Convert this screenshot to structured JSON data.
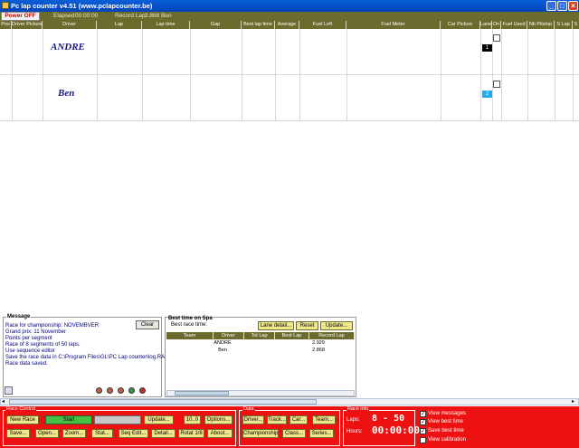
{
  "window": {
    "title": "Pc lap counter v4.51 (www.pclapcounter.be)"
  },
  "header": {
    "power_button": "Power OFF",
    "elapsed_label": "Elapsed :",
    "elapsed_value": "00:00:00",
    "record_label": "Record Lap:",
    "record_value": "2.868 Ben"
  },
  "columns": [
    "Pos",
    "Driver Picture",
    "Driver",
    "Lap",
    "Lap time",
    "Gap",
    "Best lap time",
    "Average",
    "Fuel Left",
    "Fuel Meter",
    "Car Picture",
    "Lane",
    "On",
    "Fuel Used",
    "Nb Pitstop",
    "S Lap",
    "S"
  ],
  "rows": [
    {
      "driver": "ANDRE",
      "lane": "1",
      "lane_color": "#000000"
    },
    {
      "driver": "Ben",
      "lane": "2",
      "lane_color": "#22aaee"
    }
  ],
  "message": {
    "title": "Message",
    "clear": "Clear",
    "lines": [
      "Race for championship: NOVEMBVER",
      "Grand prix: 11 November",
      "Points per segment",
      "Race of 8 segments of 50 laps.",
      "Use sequence editor",
      "Save the race data in C:\\Program Files\\GL\\PC Lap counter\\log.RAC",
      "Race data saved."
    ]
  },
  "best": {
    "title": "Best time on Spa",
    "subtitle": "Best race time:",
    "lane_detail": "Lane detail...",
    "reset": "Reset",
    "update": "Update...",
    "headers": [
      "Team",
      "Driver",
      "Tot Lap",
      "Best Lap",
      "Record Lap"
    ],
    "rows": [
      {
        "driver": "ANDRE",
        "record": "2.929"
      },
      {
        "driver": "Ben",
        "record": "2.868"
      }
    ]
  },
  "race_control": {
    "label": "Race Control",
    "new_race": "New Race",
    "start": "Start",
    "update": "Update...",
    "num": "10..0",
    "options": "Options...",
    "save": "Save...",
    "open": "Open...",
    "zoom": "Zoom...",
    "stat": "Stat...",
    "seq_edit": "Seq Edit...",
    "detail": "Detail...",
    "rotat": "Rotat 1/8",
    "about": "About..."
  },
  "data": {
    "label": "Data",
    "driver": "Driver...",
    "track": "Track...",
    "car": "Car...",
    "team": "Team...",
    "championship": "Championship...",
    "class": "Class...",
    "series": "Series..."
  },
  "race_info": {
    "label": "Race info",
    "laps_label": "Laps:",
    "laps_value": "8 - 50",
    "hours_label": "Hours:",
    "hours_value": "00:00:00"
  },
  "options": [
    {
      "label": "View messages",
      "checked": true
    },
    {
      "label": "View best time",
      "checked": true
    },
    {
      "label": "Save best time",
      "checked": true
    },
    {
      "label": "View calibration",
      "checked": false
    }
  ],
  "colors": {
    "accent": "#6b6b2e",
    "control": "#ee1111",
    "title": "#0a5fd8"
  }
}
